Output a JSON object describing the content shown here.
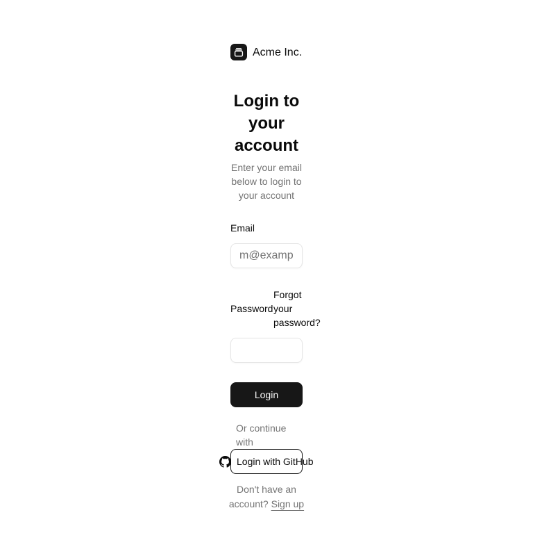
{
  "brand": {
    "name": "Acme Inc.",
    "logo_icon": "gallery-stack-icon"
  },
  "form": {
    "title": "Login to your account",
    "subtitle": "Enter your email below to login to your account",
    "email": {
      "label": "Email",
      "placeholder": "m@example.com",
      "value": ""
    },
    "password": {
      "label": "Password",
      "forgot_label": "Forgot your password?",
      "value": ""
    },
    "login_label": "Login",
    "divider_text": "Or continue with",
    "github_label": "Login with GitHub",
    "signup_prompt": "Don't have an account?",
    "signup_link": "Sign up"
  },
  "colors": {
    "primary": "#171717",
    "muted": "#737373",
    "border": "#e5e5e5"
  }
}
